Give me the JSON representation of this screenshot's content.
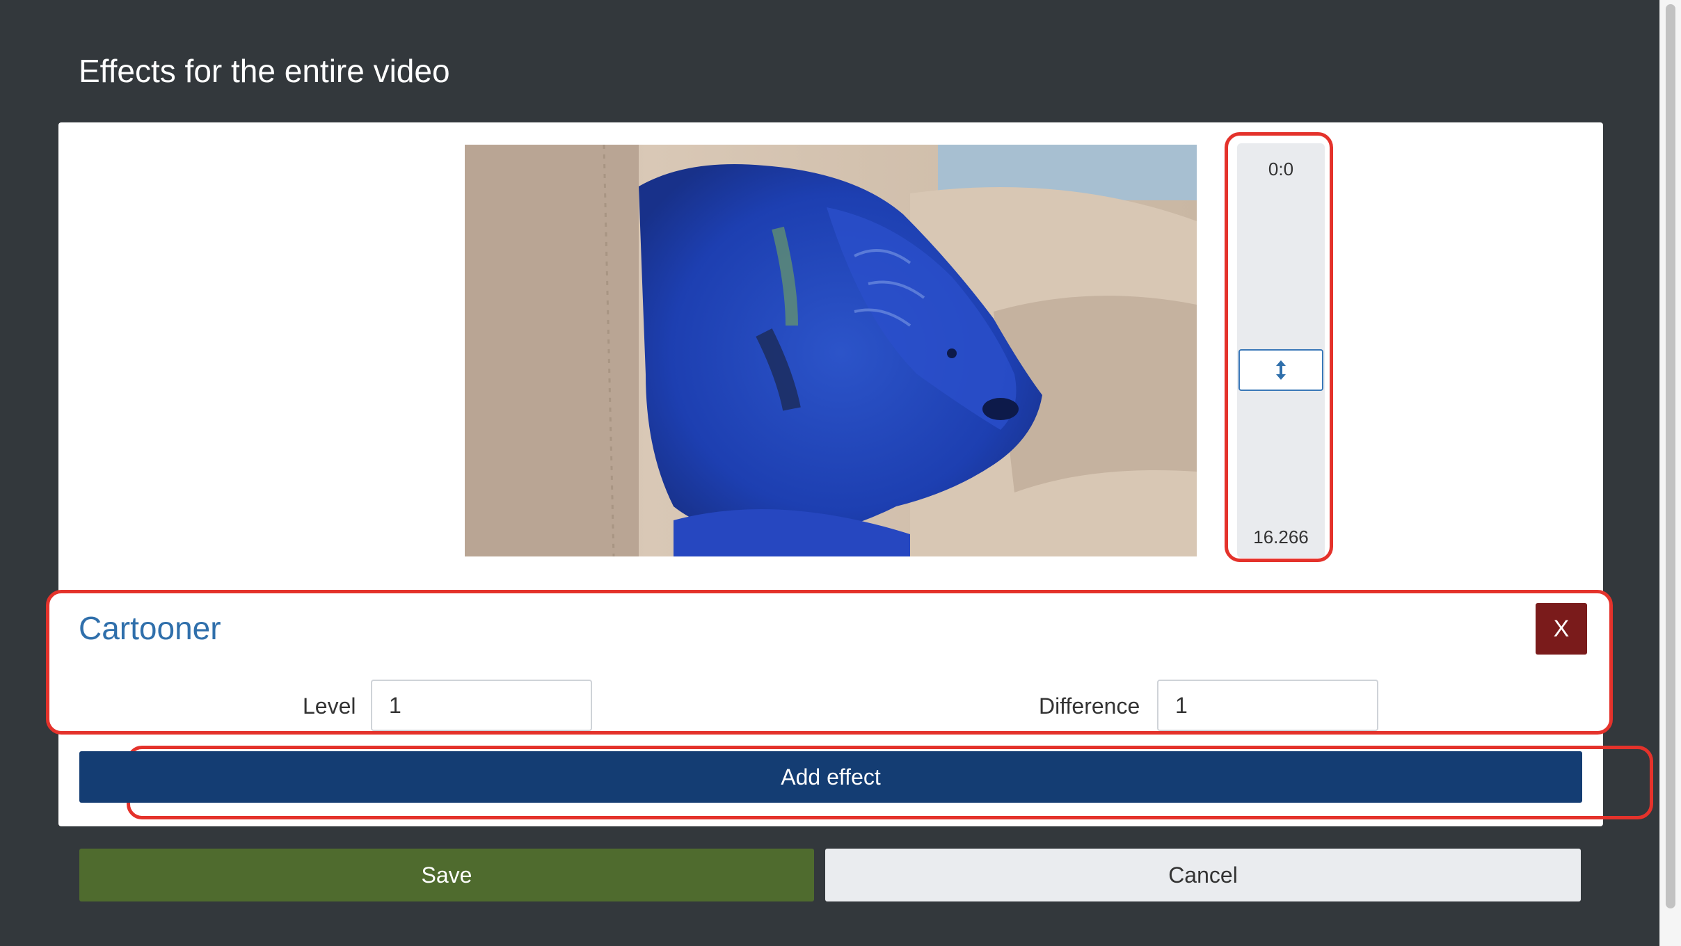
{
  "page": {
    "title": "Effects for the entire video"
  },
  "timeline": {
    "start_label": "0:0",
    "end_label": "16.266",
    "handle_icon": "vertical-resize-icon"
  },
  "effects": [
    {
      "name": "Cartooner",
      "remove_label": "X",
      "params": [
        {
          "label": "Level",
          "value": "1"
        },
        {
          "label": "Difference",
          "value": "1"
        }
      ]
    }
  ],
  "actions": {
    "add_effect_label": "Add effect",
    "save_label": "Save",
    "cancel_label": "Cancel"
  },
  "colors": {
    "background": "#33383c",
    "effect_title": "#2f6fab",
    "remove_button": "#7a1b1b",
    "add_effect_button": "#143d73",
    "save_button": "#4f6b2e",
    "cancel_button": "#eaecef",
    "highlight": "#e4322b"
  }
}
